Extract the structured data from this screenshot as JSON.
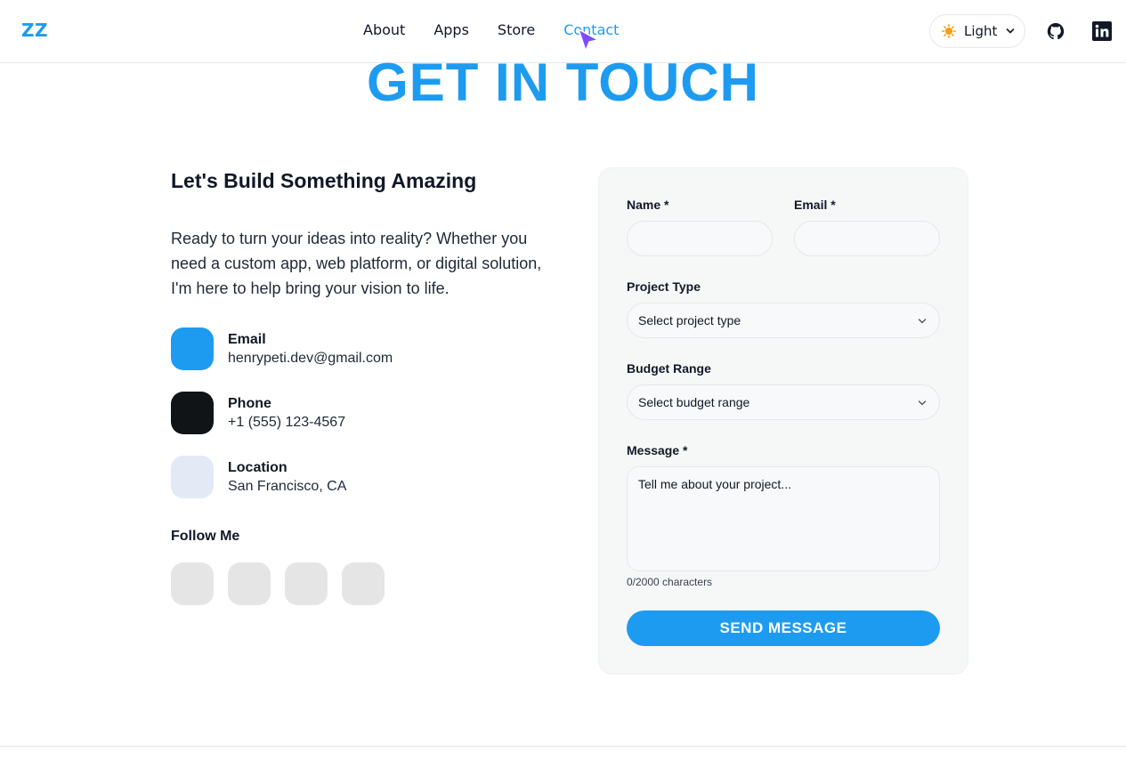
{
  "header": {
    "logo": "ZZ",
    "nav": [
      {
        "label": "About",
        "active": false
      },
      {
        "label": "Apps",
        "active": false
      },
      {
        "label": "Store",
        "active": false
      },
      {
        "label": "Contact",
        "active": true
      }
    ],
    "theme_label": "Light",
    "accent_color": "#1d9bf0"
  },
  "page": {
    "title": "GET IN TOUCH"
  },
  "intro": {
    "heading": "Let's Build Something Amazing",
    "text": "Ready to turn your ideas into reality? Whether you need a custom app, web platform, or digital solution, I'm here to help bring your vision to life."
  },
  "contacts": [
    {
      "label": "Email",
      "value": "henrypeti.dev@gmail.com",
      "color": "#1d9bf0"
    },
    {
      "label": "Phone",
      "value": "+1 (555) 123-4567",
      "color": "#111417"
    },
    {
      "label": "Location",
      "value": "San Francisco, CA",
      "color": "#e3eaf5"
    }
  ],
  "follow": {
    "heading": "Follow Me",
    "count": 4
  },
  "form": {
    "name_label": "Name *",
    "email_label": "Email *",
    "name_value": "",
    "email_value": "",
    "project_type_label": "Project Type",
    "project_type_placeholder": "Select project type",
    "budget_label": "Budget Range",
    "budget_placeholder": "Select budget range",
    "message_label": "Message *",
    "message_placeholder": "Tell me about your project...",
    "char_count": "0/2000 characters",
    "submit_label": "SEND MESSAGE"
  }
}
